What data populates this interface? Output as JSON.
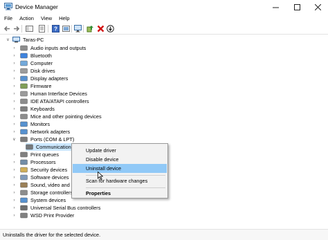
{
  "window": {
    "title": "Device Manager"
  },
  "menu": [
    "File",
    "Action",
    "View",
    "Help"
  ],
  "toolbar": [
    "back",
    "forward",
    "show-hide-console-tree",
    "properties",
    "help",
    "show-hidden",
    "scan-for-hardware",
    "update-driver",
    "uninstall",
    "disable"
  ],
  "tree": {
    "root": "Taras-PC",
    "categories": [
      {
        "label": "Audio inputs and outputs",
        "icon": "speaker-icon"
      },
      {
        "label": "Bluetooth",
        "icon": "bluetooth-icon"
      },
      {
        "label": "Computer",
        "icon": "computer-icon"
      },
      {
        "label": "Disk drives",
        "icon": "disk-icon"
      },
      {
        "label": "Display adapters",
        "icon": "display-icon"
      },
      {
        "label": "Firmware",
        "icon": "chip-icon"
      },
      {
        "label": "Human Interface Devices",
        "icon": "hid-icon"
      },
      {
        "label": "IDE ATA/ATAPI controllers",
        "icon": "ide-icon"
      },
      {
        "label": "Keyboards",
        "icon": "keyboard-icon"
      },
      {
        "label": "Mice and other pointing devices",
        "icon": "mouse-icon"
      },
      {
        "label": "Monitors",
        "icon": "monitor-icon"
      },
      {
        "label": "Network adapters",
        "icon": "network-icon"
      },
      {
        "label": "Ports (COM & LPT)",
        "icon": "port-icon"
      },
      {
        "label": "Communications",
        "icon": "port-icon"
      },
      {
        "label": "Print queues",
        "icon": "printer-icon"
      },
      {
        "label": "Processors",
        "icon": "processor-icon"
      },
      {
        "label": "Security devices",
        "icon": "security-icon"
      },
      {
        "label": "Software devices",
        "icon": "software-icon"
      },
      {
        "label": "Sound, video and ga",
        "icon": "sound-icon"
      },
      {
        "label": "Storage controllers",
        "icon": "storage-icon"
      },
      {
        "label": "System devices",
        "icon": "system-icon"
      },
      {
        "label": "Universal Serial Bus controllers",
        "icon": "usb-icon"
      },
      {
        "label": "WSD Print Provider",
        "icon": "printer-icon"
      }
    ]
  },
  "context_menu": {
    "items": [
      "Update driver",
      "Disable device",
      "Uninstall device",
      "Scan for hardware changes",
      "Properties"
    ],
    "highlighted": "Uninstall device"
  },
  "status": {
    "text": "Uninstalls the driver for the selected device."
  },
  "colors": {
    "selection": "#cce8ff",
    "menu_highlight": "#91c9f7"
  }
}
